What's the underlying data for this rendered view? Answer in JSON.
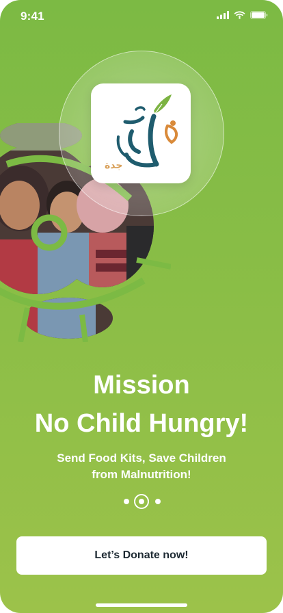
{
  "status_bar": {
    "time": "9:41"
  },
  "logo": {
    "arabic_text": "جدة"
  },
  "headline": {
    "line1": "Mission",
    "line2": "No Child Hungry!"
  },
  "subtitle": {
    "line1": "Send Food Kits, Save Children",
    "line2": "from Malnutrition!"
  },
  "pager": {
    "total_pages": 3,
    "active_page": 2
  },
  "donate_button": {
    "label": "Let’s Donate now!"
  },
  "colors": {
    "background_top": "#7cba44",
    "background_bottom": "#9cc24a",
    "logo_teal": "#1f5c6e",
    "logo_orange": "#d98a3a",
    "logo_leaf": "#7cb342",
    "button_text": "#1e2a33"
  }
}
